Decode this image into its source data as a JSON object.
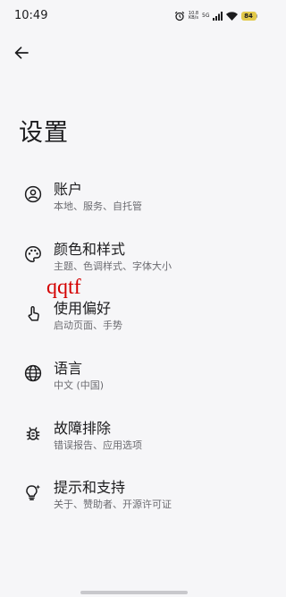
{
  "status_bar": {
    "time": "10:49",
    "net_speed_value": "10.8",
    "net_speed_unit": "KB/s",
    "network_type": "5G",
    "battery": "84"
  },
  "header": {
    "title": "设置"
  },
  "settings": {
    "items": [
      {
        "icon": "account-icon",
        "title": "账户",
        "subtitle": "本地、服务、自托管"
      },
      {
        "icon": "palette-icon",
        "title": "颜色和样式",
        "subtitle": "主题、色调样式、字体大小"
      },
      {
        "icon": "touch-icon",
        "title": "使用偏好",
        "subtitle": "启动页面、手势"
      },
      {
        "icon": "globe-icon",
        "title": "语言",
        "subtitle": "中文 (中国)"
      },
      {
        "icon": "bug-icon",
        "title": "故障排除",
        "subtitle": "错误报告、应用选项"
      },
      {
        "icon": "tips-icon",
        "title": "提示和支持",
        "subtitle": "关于、赞助者、开源许可证"
      }
    ]
  },
  "overlay": {
    "text": "qqtf"
  }
}
